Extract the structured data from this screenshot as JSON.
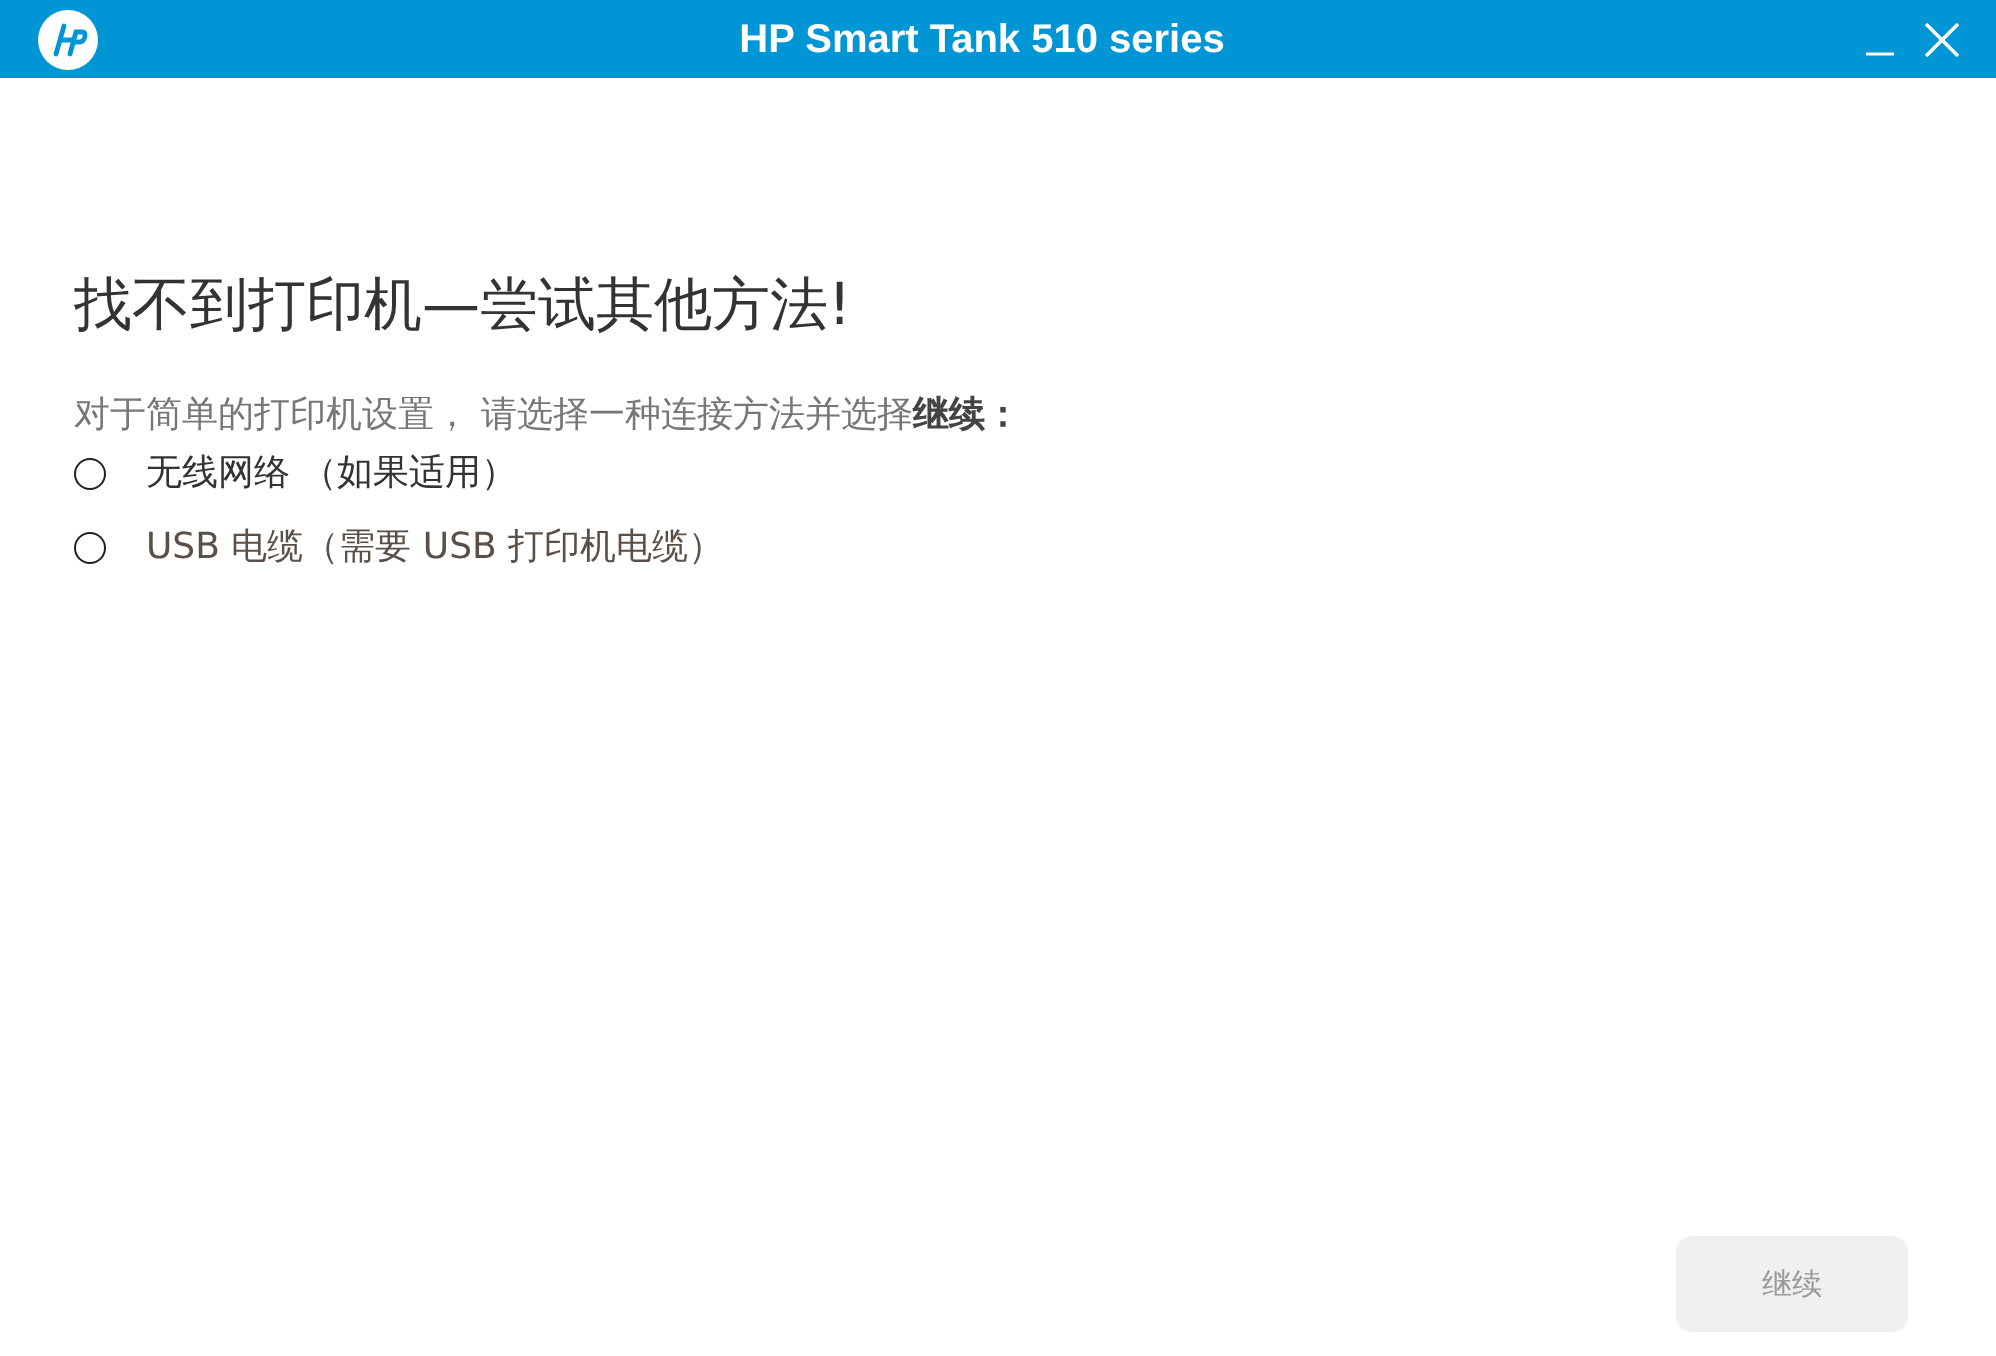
{
  "window": {
    "title": "HP Smart Tank 510 series"
  },
  "heading": "找不到打印机—尝试其他方法!",
  "instruction": "对于简单的打印机设置， 请选择一种连接方法并选择**继续：**",
  "options": [
    {
      "label": "无线网络 （如果适用）",
      "selected": false
    },
    {
      "label": "USB 电缆（需要 USB 打印机电缆）",
      "selected": false
    }
  ],
  "continue_button": {
    "label": "继续",
    "disabled": true
  }
}
